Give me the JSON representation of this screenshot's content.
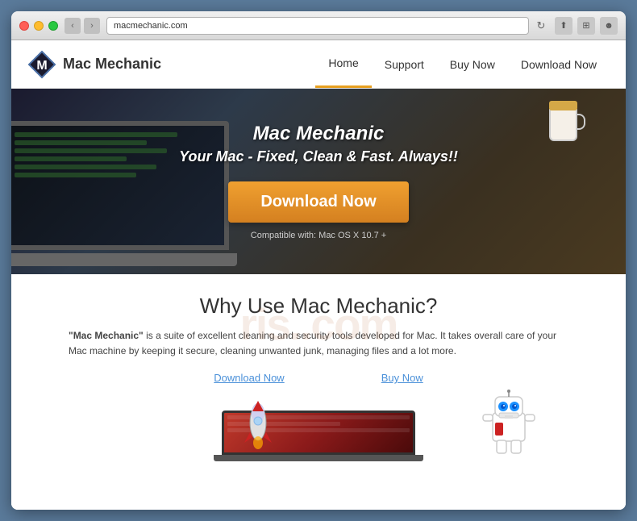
{
  "browser": {
    "address": "macmechanic.com",
    "nav": {
      "back": "‹",
      "forward": "›"
    }
  },
  "nav": {
    "logo_text": "Mac Mechanic",
    "links": [
      {
        "label": "Home",
        "active": true
      },
      {
        "label": "Support",
        "active": false
      },
      {
        "label": "Buy Now",
        "active": false
      },
      {
        "label": "Download Now",
        "active": false
      }
    ]
  },
  "hero": {
    "title": "Mac Mechanic",
    "subtitle": "Your Mac - Fixed, Clean & Fast. Always!!",
    "cta_label": "Download Now",
    "compat": "Compatible with: Mac OS X 10.7 +"
  },
  "why": {
    "title": "Why Use Mac Mechanic?",
    "description_start": "\"Mac Mechanic\"",
    "description_rest": " is a suite of excellent cleaning and security tools developed for Mac. It takes overall care of your Mac machine by keeping it secure, cleaning unwanted junk, managing files and a lot more.",
    "link_download": "Download Now",
    "link_buy": "Buy Now"
  },
  "watermark": {
    "text": "ris..com"
  }
}
